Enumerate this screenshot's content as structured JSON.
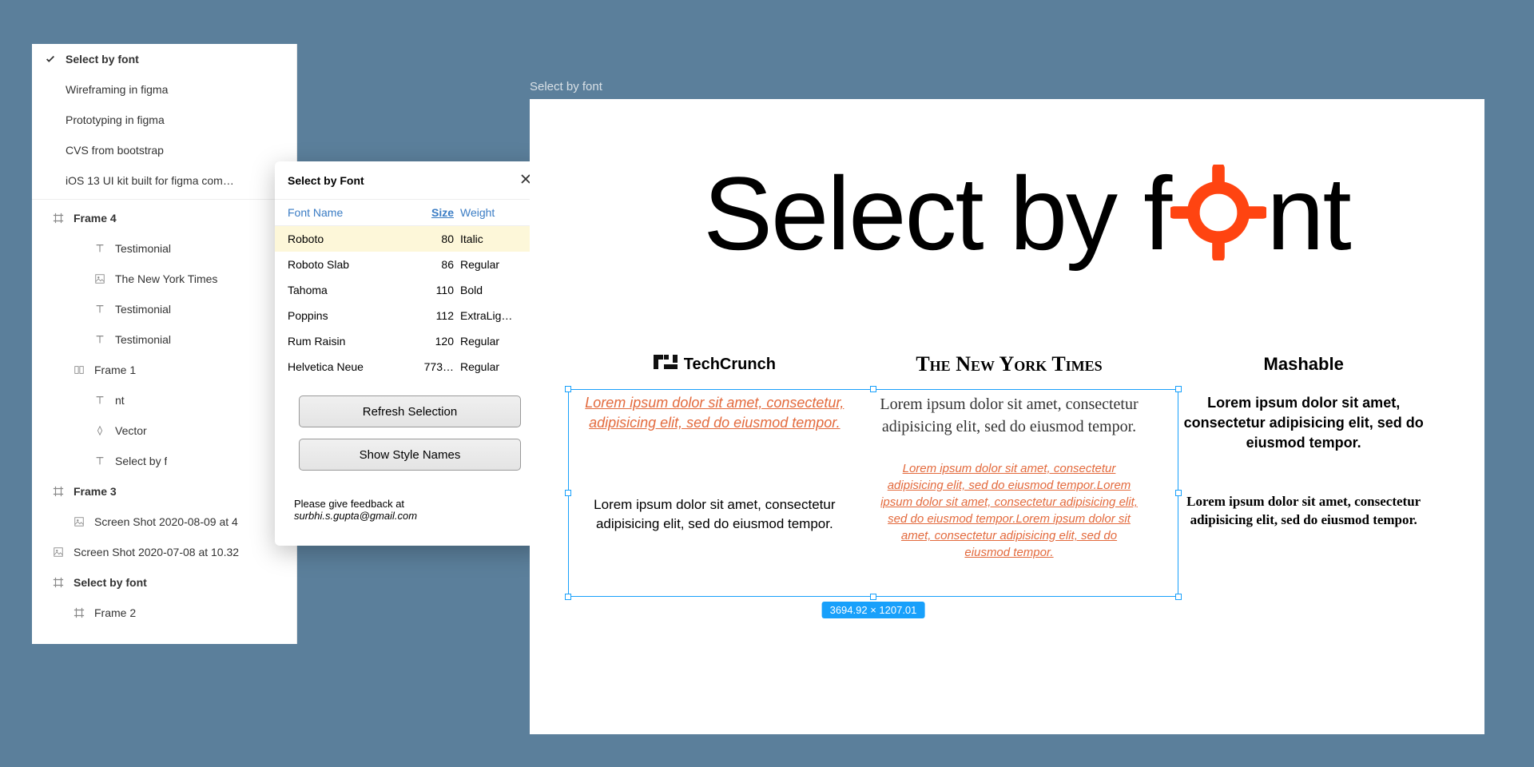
{
  "layers": {
    "pages": [
      {
        "label": "Select by font",
        "active": true
      },
      {
        "label": "Wireframing in figma",
        "active": false
      },
      {
        "label": "Prototyping in figma",
        "active": false
      },
      {
        "label": "CVS from bootstrap",
        "active": false
      },
      {
        "label": "iOS 13 UI kit built for figma com…",
        "active": false
      }
    ],
    "tree": [
      {
        "indent": 0,
        "icon": "frame",
        "label": "Frame 4",
        "bold": true
      },
      {
        "indent": 2,
        "icon": "text",
        "label": "Testimonial"
      },
      {
        "indent": 2,
        "icon": "image",
        "label": "The New York Times"
      },
      {
        "indent": 2,
        "icon": "text",
        "label": "Testimonial"
      },
      {
        "indent": 2,
        "icon": "text",
        "label": "Testimonial"
      },
      {
        "indent": 1,
        "icon": "group",
        "label": "Frame 1"
      },
      {
        "indent": 2,
        "icon": "text",
        "label": "nt"
      },
      {
        "indent": 2,
        "icon": "vector",
        "label": "Vector"
      },
      {
        "indent": 2,
        "icon": "text",
        "label": "Select by f"
      },
      {
        "indent": 0,
        "icon": "frame",
        "label": "Frame 3",
        "bold": true
      },
      {
        "indent": 1,
        "icon": "image",
        "label": "Screen Shot 2020-08-09 at 4"
      },
      {
        "indent": 0,
        "icon": "image",
        "label": "Screen Shot 2020-07-08 at 10.32"
      },
      {
        "indent": 0,
        "icon": "frame",
        "label": "Select by font",
        "bold": true
      },
      {
        "indent": 1,
        "icon": "frame",
        "label": "Frame 2"
      }
    ]
  },
  "plugin": {
    "title": "Select by Font",
    "headers": {
      "name": "Font Name",
      "size": "Size",
      "weight": "Weight"
    },
    "rows": [
      {
        "name": "Roboto",
        "size": "80",
        "weight": "Italic",
        "selected": true
      },
      {
        "name": "Roboto Slab",
        "size": "86",
        "weight": "Regular"
      },
      {
        "name": "Tahoma",
        "size": "110",
        "weight": "Bold"
      },
      {
        "name": "Poppins",
        "size": "112",
        "weight": "ExtraLig…"
      },
      {
        "name": "Rum Raisin",
        "size": "120",
        "weight": "Regular"
      },
      {
        "name": "Helvetica Neue",
        "size": "773…",
        "weight": "Regular"
      }
    ],
    "refresh": "Refresh Selection",
    "show_styles": "Show Style Names",
    "feedback_label": "Please give feedback at",
    "feedback_email": "surbhi.s.gupta@gmail.com"
  },
  "canvas": {
    "frame_label": "Select by font",
    "logo_pre": "Select by f",
    "logo_post": "nt",
    "brands": {
      "tc": "TechCrunch",
      "nyt": "The New York Times",
      "mash": "Mashable"
    },
    "lorem_short": "Lorem ipsum dolor sit amet, consectetur, adipisicing elit, sed do eiusmod tempor.",
    "lorem_serif": "Lorem ipsum dolor sit amet, consectetur adipisicing elit, sed do eiusmod tempor.",
    "lorem_bold": "Lorem ipsum dolor sit amet, consectetur adipisicing elit, sed do eiusmod tempor.",
    "lorem_plain": "Lorem ipsum dolor sit amet, consectetur adipisicing elit, sed do eiusmod tempor.",
    "lorem_long_red": "Lorem ipsum dolor sit amet, consectetur adipisicing elit, sed do eiusmod tempor.Lorem ipsum dolor sit amet, consectetur adipisicing elit, sed do eiusmod tempor.Lorem ipsum dolor sit amet, consectetur adipisicing elit, sed do eiusmod tempor.",
    "lorem_rum": "Lorem ipsum dolor sit amet, consectetur adipisicing elit, sed do eiusmod tempor.",
    "selection_size": "3694.92 × 1207.01"
  }
}
